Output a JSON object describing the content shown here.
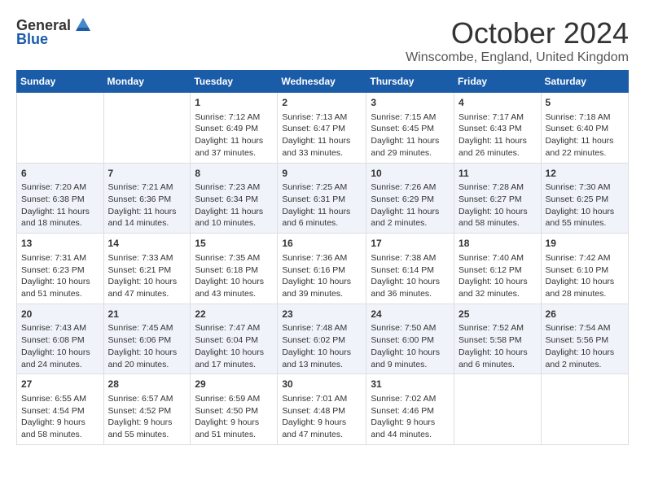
{
  "logo": {
    "general": "General",
    "blue": "Blue"
  },
  "title": "October 2024",
  "location": "Winscombe, England, United Kingdom",
  "days_of_week": [
    "Sunday",
    "Monday",
    "Tuesday",
    "Wednesday",
    "Thursday",
    "Friday",
    "Saturday"
  ],
  "weeks": [
    [
      {
        "day": "",
        "content": ""
      },
      {
        "day": "",
        "content": ""
      },
      {
        "day": "1",
        "content": "Sunrise: 7:12 AM\nSunset: 6:49 PM\nDaylight: 11 hours and 37 minutes."
      },
      {
        "day": "2",
        "content": "Sunrise: 7:13 AM\nSunset: 6:47 PM\nDaylight: 11 hours and 33 minutes."
      },
      {
        "day": "3",
        "content": "Sunrise: 7:15 AM\nSunset: 6:45 PM\nDaylight: 11 hours and 29 minutes."
      },
      {
        "day": "4",
        "content": "Sunrise: 7:17 AM\nSunset: 6:43 PM\nDaylight: 11 hours and 26 minutes."
      },
      {
        "day": "5",
        "content": "Sunrise: 7:18 AM\nSunset: 6:40 PM\nDaylight: 11 hours and 22 minutes."
      }
    ],
    [
      {
        "day": "6",
        "content": "Sunrise: 7:20 AM\nSunset: 6:38 PM\nDaylight: 11 hours and 18 minutes."
      },
      {
        "day": "7",
        "content": "Sunrise: 7:21 AM\nSunset: 6:36 PM\nDaylight: 11 hours and 14 minutes."
      },
      {
        "day": "8",
        "content": "Sunrise: 7:23 AM\nSunset: 6:34 PM\nDaylight: 11 hours and 10 minutes."
      },
      {
        "day": "9",
        "content": "Sunrise: 7:25 AM\nSunset: 6:31 PM\nDaylight: 11 hours and 6 minutes."
      },
      {
        "day": "10",
        "content": "Sunrise: 7:26 AM\nSunset: 6:29 PM\nDaylight: 11 hours and 2 minutes."
      },
      {
        "day": "11",
        "content": "Sunrise: 7:28 AM\nSunset: 6:27 PM\nDaylight: 10 hours and 58 minutes."
      },
      {
        "day": "12",
        "content": "Sunrise: 7:30 AM\nSunset: 6:25 PM\nDaylight: 10 hours and 55 minutes."
      }
    ],
    [
      {
        "day": "13",
        "content": "Sunrise: 7:31 AM\nSunset: 6:23 PM\nDaylight: 10 hours and 51 minutes."
      },
      {
        "day": "14",
        "content": "Sunrise: 7:33 AM\nSunset: 6:21 PM\nDaylight: 10 hours and 47 minutes."
      },
      {
        "day": "15",
        "content": "Sunrise: 7:35 AM\nSunset: 6:18 PM\nDaylight: 10 hours and 43 minutes."
      },
      {
        "day": "16",
        "content": "Sunrise: 7:36 AM\nSunset: 6:16 PM\nDaylight: 10 hours and 39 minutes."
      },
      {
        "day": "17",
        "content": "Sunrise: 7:38 AM\nSunset: 6:14 PM\nDaylight: 10 hours and 36 minutes."
      },
      {
        "day": "18",
        "content": "Sunrise: 7:40 AM\nSunset: 6:12 PM\nDaylight: 10 hours and 32 minutes."
      },
      {
        "day": "19",
        "content": "Sunrise: 7:42 AM\nSunset: 6:10 PM\nDaylight: 10 hours and 28 minutes."
      }
    ],
    [
      {
        "day": "20",
        "content": "Sunrise: 7:43 AM\nSunset: 6:08 PM\nDaylight: 10 hours and 24 minutes."
      },
      {
        "day": "21",
        "content": "Sunrise: 7:45 AM\nSunset: 6:06 PM\nDaylight: 10 hours and 20 minutes."
      },
      {
        "day": "22",
        "content": "Sunrise: 7:47 AM\nSunset: 6:04 PM\nDaylight: 10 hours and 17 minutes."
      },
      {
        "day": "23",
        "content": "Sunrise: 7:48 AM\nSunset: 6:02 PM\nDaylight: 10 hours and 13 minutes."
      },
      {
        "day": "24",
        "content": "Sunrise: 7:50 AM\nSunset: 6:00 PM\nDaylight: 10 hours and 9 minutes."
      },
      {
        "day": "25",
        "content": "Sunrise: 7:52 AM\nSunset: 5:58 PM\nDaylight: 10 hours and 6 minutes."
      },
      {
        "day": "26",
        "content": "Sunrise: 7:54 AM\nSunset: 5:56 PM\nDaylight: 10 hours and 2 minutes."
      }
    ],
    [
      {
        "day": "27",
        "content": "Sunrise: 6:55 AM\nSunset: 4:54 PM\nDaylight: 9 hours and 58 minutes."
      },
      {
        "day": "28",
        "content": "Sunrise: 6:57 AM\nSunset: 4:52 PM\nDaylight: 9 hours and 55 minutes."
      },
      {
        "day": "29",
        "content": "Sunrise: 6:59 AM\nSunset: 4:50 PM\nDaylight: 9 hours and 51 minutes."
      },
      {
        "day": "30",
        "content": "Sunrise: 7:01 AM\nSunset: 4:48 PM\nDaylight: 9 hours and 47 minutes."
      },
      {
        "day": "31",
        "content": "Sunrise: 7:02 AM\nSunset: 4:46 PM\nDaylight: 9 hours and 44 minutes."
      },
      {
        "day": "",
        "content": ""
      },
      {
        "day": "",
        "content": ""
      }
    ]
  ]
}
